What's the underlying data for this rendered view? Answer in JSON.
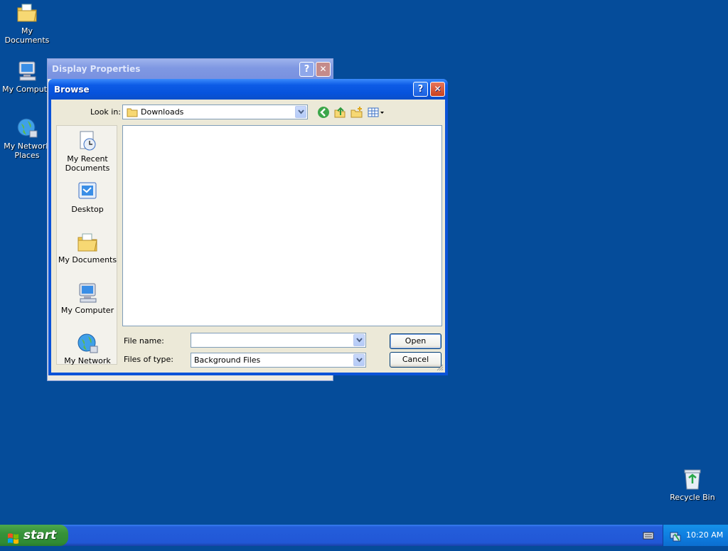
{
  "desktop": {
    "icons": [
      {
        "label": "My Documents",
        "icon": "my-documents-icon"
      },
      {
        "label": "My Compute",
        "icon": "my-computer-icon"
      },
      {
        "label": "My Network Places",
        "icon": "network-places-icon"
      },
      {
        "label": "Recycle Bin",
        "icon": "recycle-bin-icon"
      }
    ]
  },
  "background_window": {
    "title": "Display Properties",
    "help_glyph": "?",
    "close_glyph": "✕"
  },
  "dialog": {
    "title": "Browse",
    "help_glyph": "?",
    "close_glyph": "✕",
    "look_in_label": "Look in:",
    "look_in_value": "Downloads",
    "toolbar": [
      "back-icon",
      "up-folder-icon",
      "new-folder-icon",
      "views-menu-icon"
    ],
    "places": [
      {
        "label": "My Recent Documents",
        "icon": "recent-documents-icon"
      },
      {
        "label": "Desktop",
        "icon": "desktop-icon"
      },
      {
        "label": "My Documents",
        "icon": "my-documents-icon"
      },
      {
        "label": "My Computer",
        "icon": "my-computer-icon"
      },
      {
        "label": "My Network",
        "icon": "network-places-icon"
      }
    ],
    "file_name_label": "File name:",
    "file_name_value": "",
    "files_of_type_label": "Files of type:",
    "files_of_type_value": "Background Files",
    "open_label": "Open",
    "cancel_label": "Cancel"
  },
  "taskbar": {
    "start_label": "start",
    "clock": "10:20 AM"
  },
  "colors": {
    "desktop": "#054c9a",
    "title_active": "#0653dc",
    "taskbar": "#245edb",
    "start": "#37923a"
  }
}
